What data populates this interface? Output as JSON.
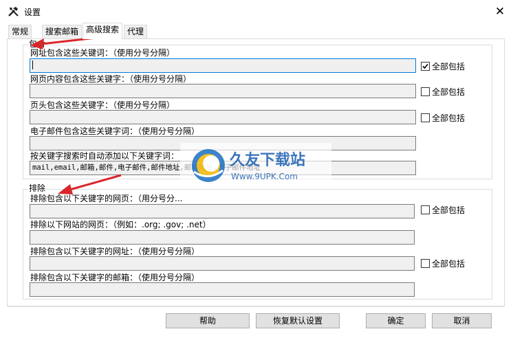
{
  "window": {
    "title": "设置",
    "close_glyph": "✕"
  },
  "tabs": [
    "常规",
    "搜索邮箱",
    "高级搜索",
    "代理"
  ],
  "include": {
    "legend": "包含",
    "rows": [
      {
        "label": "网址包含这些关键词：（使用分号分隔）",
        "value": "",
        "checkbox_label": "全部包括",
        "checked": true
      },
      {
        "label": "网页内容包含这些关键字：（使用分号分隔）",
        "value": "",
        "checkbox_label": "全部包括",
        "checked": false
      },
      {
        "label": "页头包含这些关键字：（使用分号分隔）",
        "value": "",
        "checkbox_label": "全部包括",
        "checked": false
      },
      {
        "label": "电子邮件包含这些关键字词：（使用分号分隔）",
        "value": ""
      },
      {
        "label": "按关键字搜索时自动添加以下关键字词：",
        "value": "mail,email,邮箱,邮件,电子邮件,邮件地址,邮箱地址,电子邮件地址"
      }
    ]
  },
  "exclude": {
    "legend": "排除",
    "rows": [
      {
        "label": "排除包含以下关键字的网页：（用分号分...",
        "value": "",
        "checkbox_label": "全部包括",
        "checked": false
      },
      {
        "label": "排除以下网站的网页：（例如：.org; .gov; .net）",
        "value": ""
      },
      {
        "label": "排除包含以下关键字的网址：（使用分号分隔）",
        "value": "",
        "checkbox_label": "全部包括",
        "checked": false
      },
      {
        "label": "排除包含以下关键字的邮箱：（使用分号分隔）",
        "value": ""
      }
    ]
  },
  "buttons": {
    "help": "帮助",
    "restore": "恢复默认设置",
    "ok": "确定",
    "cancel": "取消"
  },
  "watermark": {
    "brand": "久友下载站",
    "url": "Www.9UPK.Com"
  },
  "colors": {
    "arrow": "#d9262a",
    "accent": "#0078d7",
    "button_bg": "#e1e1e1"
  }
}
